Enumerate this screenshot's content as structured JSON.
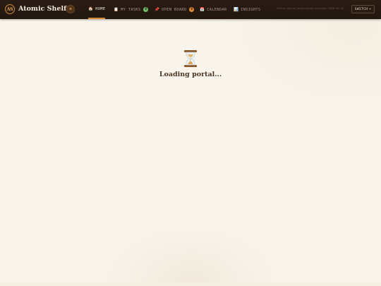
{
  "app": {
    "logo_text": "AS",
    "brand": "Atomic Shelf"
  },
  "nav": {
    "tabs": [
      {
        "label": "HOME",
        "icon": "house-icon",
        "glyph": "🏠",
        "active": true
      },
      {
        "label": "MY TASKS",
        "icon": "clipboard-icon",
        "glyph": "📋",
        "badge": "8",
        "badge_color": "#6fbf6a"
      },
      {
        "label": "OPEN BOARD",
        "icon": "pin-icon",
        "glyph": "📌",
        "badge": "8",
        "badge_color": "#e08a3a"
      },
      {
        "label": "CALENDAR",
        "icon": "calendar-icon",
        "glyph": "📅"
      },
      {
        "label": "INSIGHTS",
        "icon": "chart-icon",
        "glyph": "📊"
      }
    ]
  },
  "header": {
    "slug": "rdetor-portal-pencildaay-calendar-2016-05-22",
    "switch_label": "SWITCH",
    "switch_caret": "▾",
    "theme_glyph": "☀"
  },
  "loader": {
    "icon": "hourglass-icon",
    "text": "Loading portal..."
  },
  "colors": {
    "topbar": "#22170f",
    "accent": "#d9893a",
    "background": "#faf5ec"
  }
}
